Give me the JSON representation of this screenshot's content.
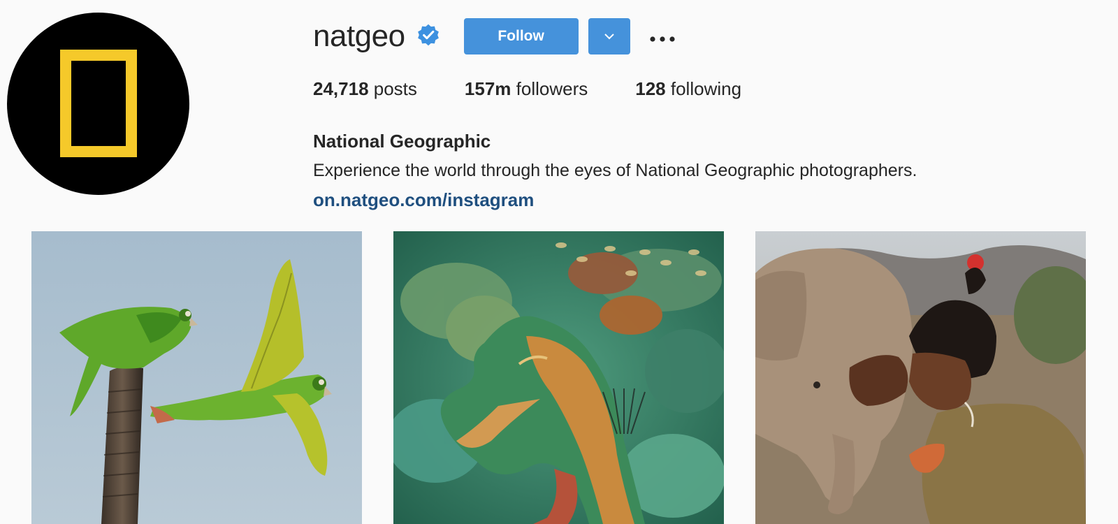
{
  "profile": {
    "username": "natgeo",
    "verified": true,
    "follow_label": "Follow",
    "stats": {
      "posts_count": "24,718",
      "posts_label": "posts",
      "followers_count": "157m",
      "followers_label": "followers",
      "following_count": "128",
      "following_label": "following"
    },
    "full_name": "National Geographic",
    "bio": "Experience the world through the eyes of National Geographic photographers.",
    "link": "on.natgeo.com/instagram"
  },
  "icons": {
    "verified": "verified-badge-icon",
    "dropdown": "chevron-down-icon",
    "more": "more-options-icon"
  },
  "colors": {
    "accent": "#4592db",
    "link": "#1f4f7f",
    "logo_frame": "#f5c92a",
    "background": "#fafafa"
  },
  "posts": [
    {
      "subject": "parrots"
    },
    {
      "subject": "octopus"
    },
    {
      "subject": "elephant"
    }
  ]
}
